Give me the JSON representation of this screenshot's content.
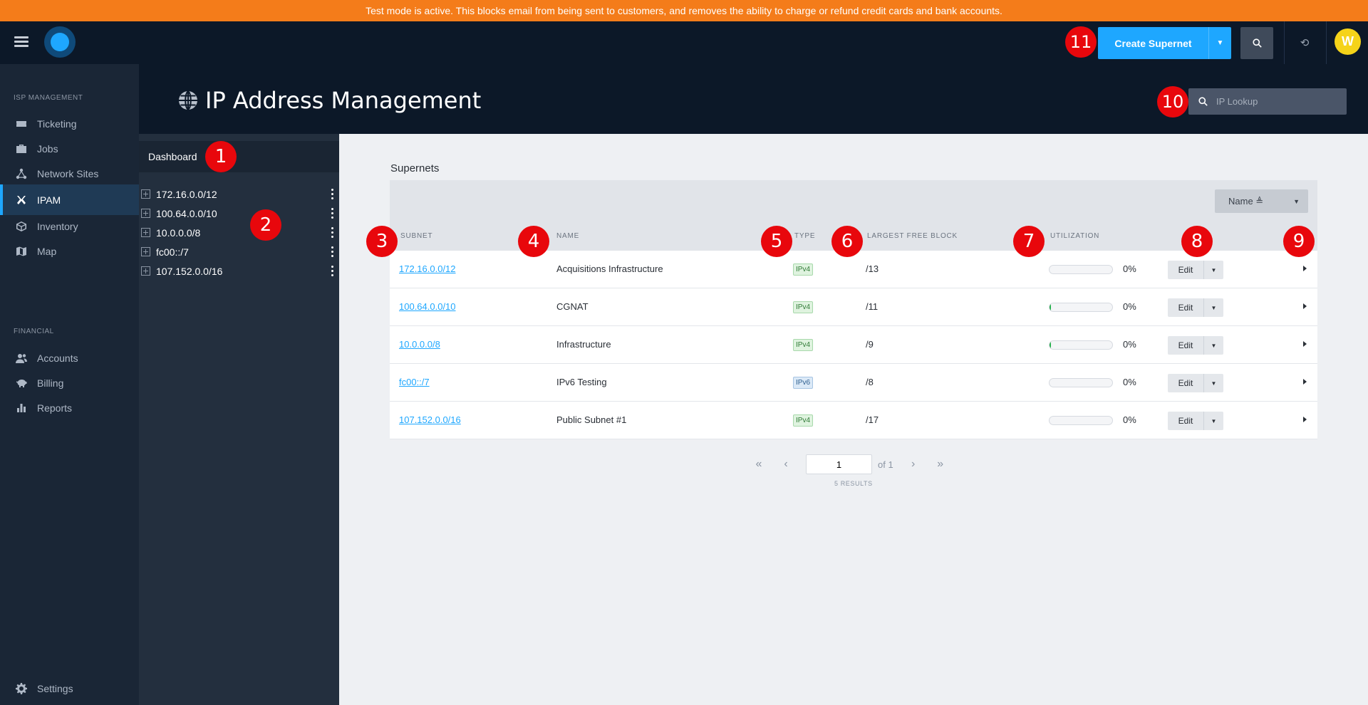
{
  "banner": "Test mode is active. This blocks email from being sent to customers, and removes the ability to charge or refund credit cards and bank accounts.",
  "topbar": {
    "create_label": "Create Supernet",
    "avatar_initial": "W",
    "accent": "#1ea7ff"
  },
  "sidebar": {
    "sections": [
      {
        "title": "ISP MANAGEMENT"
      },
      {
        "title": "FINANCIAL"
      }
    ],
    "items": [
      {
        "label": "Ticketing",
        "icon": "ticket-icon"
      },
      {
        "label": "Jobs",
        "icon": "briefcase-icon"
      },
      {
        "label": "Network Sites",
        "icon": "network-icon"
      },
      {
        "label": "IPAM",
        "icon": "ipam-icon",
        "active": true
      },
      {
        "label": "Inventory",
        "icon": "cube-icon"
      },
      {
        "label": "Map",
        "icon": "map-icon"
      },
      {
        "label": "Accounts",
        "icon": "users-icon"
      },
      {
        "label": "Billing",
        "icon": "piggy-bank-icon"
      },
      {
        "label": "Reports",
        "icon": "bar-chart-icon"
      },
      {
        "label": "Settings",
        "icon": "gear-icon"
      }
    ]
  },
  "header": {
    "title": "IP Address Management",
    "ip_lookup_placeholder": "IP Lookup"
  },
  "tree": {
    "dashboard_label": "Dashboard",
    "items": [
      "172.16.0.0/12",
      "100.64.0.0/10",
      "10.0.0.0/8",
      "fc00::/7",
      "107.152.0.0/16"
    ]
  },
  "main": {
    "section_label": "Supernets",
    "sort_label": "Name ≜",
    "columns": {
      "subnet": "SUBNET",
      "name": "NAME",
      "type": "TYPE",
      "largest_free_block": "LARGEST FREE BLOCK",
      "utilization": "UTILIZATION"
    },
    "rows": [
      {
        "subnet": "172.16.0.0/12",
        "name": "Acquisitions Infrastructure",
        "type": "IPv4",
        "free": "/13",
        "util": "0%",
        "fill": 0
      },
      {
        "subnet": "100.64.0.0/10",
        "name": "CGNAT",
        "type": "IPv4",
        "free": "/11",
        "util": "0%",
        "fill": 0.02
      },
      {
        "subnet": "10.0.0.0/8",
        "name": "Infrastructure",
        "type": "IPv4",
        "free": "/9",
        "util": "0%",
        "fill": 0.02
      },
      {
        "subnet": "fc00::/7",
        "name": "IPv6 Testing",
        "type": "IPv6",
        "free": "/8",
        "util": "0%",
        "fill": 0
      },
      {
        "subnet": "107.152.0.0/16",
        "name": "Public Subnet #1",
        "type": "IPv4",
        "free": "/17",
        "util": "0%",
        "fill": 0
      }
    ],
    "edit_label": "Edit",
    "pager": {
      "page": "1",
      "of_label": "of 1",
      "results": "5 RESULTS"
    }
  },
  "annotations": [
    "1",
    "2",
    "3",
    "4",
    "5",
    "6",
    "7",
    "8",
    "9",
    "10",
    "11"
  ]
}
